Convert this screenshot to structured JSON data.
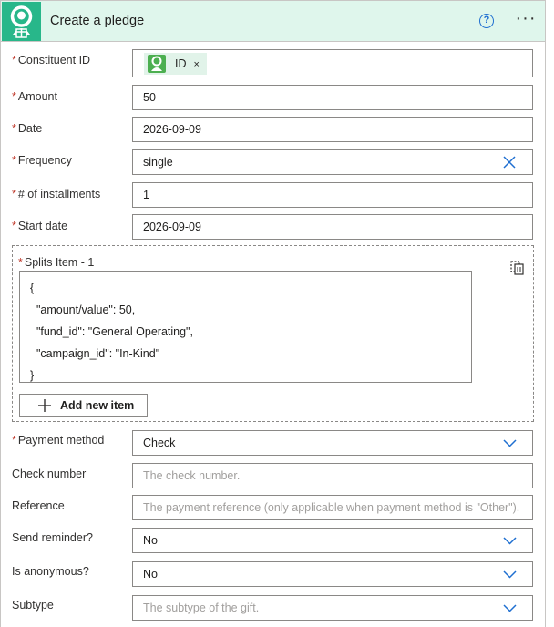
{
  "header": {
    "title": "Create a pledge",
    "help_glyph": "?",
    "more_glyph": "···",
    "bg_color": "#dff6ec",
    "icon_color": "#28b78a"
  },
  "fields": {
    "constituent_id": {
      "label": "Constituent ID",
      "required": true,
      "token": "ID",
      "token_remove": "×"
    },
    "amount": {
      "label": "Amount",
      "required": true,
      "value": "50"
    },
    "date": {
      "label": "Date",
      "required": true,
      "value": "2026-09-09"
    },
    "frequency": {
      "label": "Frequency",
      "required": true,
      "value": "single"
    },
    "installments": {
      "label": "# of installments",
      "required": true,
      "value": "1"
    },
    "start_date": {
      "label": "Start date",
      "required": true,
      "value": "2026-09-09"
    },
    "payment_method": {
      "label": "Payment method",
      "required": true,
      "value": "Check"
    },
    "check_number": {
      "label": "Check number",
      "placeholder": "The check number."
    },
    "reference": {
      "label": "Reference",
      "placeholder": "The payment reference (only applicable when payment method is \"Other\")."
    },
    "send_reminder": {
      "label": "Send reminder?",
      "value": "No"
    },
    "is_anonymous": {
      "label": "Is anonymous?",
      "value": "No"
    },
    "subtype": {
      "label": "Subtype",
      "placeholder": "The subtype of the gift."
    }
  },
  "splits": {
    "label": "Splits Item - 1",
    "required": true,
    "json_lines": [
      "{",
      "  \"amount/value\": 50,",
      "  \"fund_id\": \"General Operating\",",
      "  \"campaign_id\": \"In-Kind\"",
      "}"
    ],
    "add_button": "Add new item"
  },
  "required_marker": "*",
  "colors": {
    "accent_blue": "#1f6fd1",
    "required_red": "#c0392b",
    "border": "#8a8886"
  }
}
